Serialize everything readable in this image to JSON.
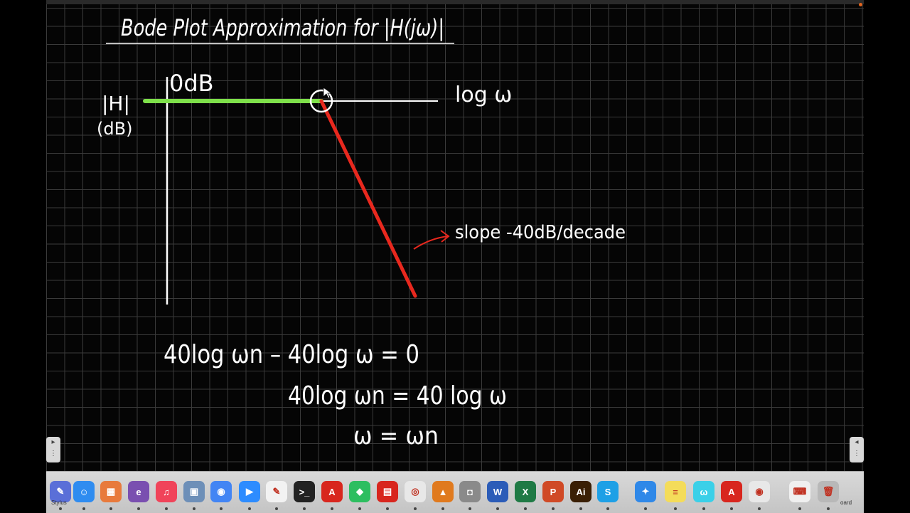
{
  "whiteboard": {
    "title": "Bode Plot Approximation for |H(jω)|",
    "y_axis_label_line1": "|H|",
    "y_axis_label_line2": "(dB)",
    "x_axis_label": "log ω",
    "zero_db_label": "0dB",
    "slope_annotation": "slope -40dB/decade",
    "equation_1": "40log ωn – 40log ω = 0",
    "equation_2": "40log ωn = 40 log ω",
    "equation_3": "ω = ωn",
    "colors": {
      "flat_segment": "#7ee04a",
      "slope_segment": "#e8281e",
      "ink": "#ffffff",
      "slope_text": "#e8281e"
    }
  },
  "side_tabs": {
    "left_icon": "panel-toggle-icon",
    "right_icon": "panel-toggle-icon"
  },
  "dock": {
    "left_label": "Stylus",
    "right_label": "oard",
    "apps": [
      {
        "name": "Stylus",
        "icon": "pen-icon",
        "color": "#5a6fd8",
        "glyph": "✎"
      },
      {
        "name": "Finder",
        "icon": "finder-icon",
        "color": "#2f8cf0",
        "glyph": "☺"
      },
      {
        "name": "Launchpad",
        "icon": "grid-icon",
        "color": "#e87a3c",
        "glyph": "▦"
      },
      {
        "name": "Emacs",
        "icon": "emacs-icon",
        "color": "#7a4fb0",
        "glyph": "e"
      },
      {
        "name": "Music",
        "icon": "music-icon",
        "color": "#f0445a",
        "glyph": "♫"
      },
      {
        "name": "Preview",
        "icon": "preview-icon",
        "color": "#6d8fb8",
        "glyph": "▣"
      },
      {
        "name": "Chrome",
        "icon": "chrome-icon",
        "color": "#4285f4",
        "glyph": "◉"
      },
      {
        "name": "Zoom",
        "icon": "video-icon",
        "color": "#2d8cff",
        "glyph": "▶"
      },
      {
        "name": "Notes",
        "icon": "edit-icon",
        "color": "#f2f2f2",
        "glyph": "✎"
      },
      {
        "name": "Terminal",
        "icon": "terminal-icon",
        "color": "#222222",
        "glyph": ">_"
      },
      {
        "name": "Acrobat",
        "icon": "pdf-icon",
        "color": "#d8261e",
        "glyph": "A"
      },
      {
        "name": "Evernote",
        "icon": "evernote-icon",
        "color": "#2dbe60",
        "glyph": "◆"
      },
      {
        "name": "Reader",
        "icon": "pdf-reader-icon",
        "color": "#d8261e",
        "glyph": "▤"
      },
      {
        "name": "Screen Recorder",
        "icon": "record-icon",
        "color": "#e8e8e8",
        "glyph": "◎"
      },
      {
        "name": "MATLAB",
        "icon": "matlab-icon",
        "color": "#e07a1e",
        "glyph": "▲"
      },
      {
        "name": "Screenshot",
        "icon": "camera-icon",
        "color": "#8a8a8a",
        "glyph": "◘"
      },
      {
        "name": "Word",
        "icon": "word-icon",
        "color": "#2b5cb8",
        "glyph": "W"
      },
      {
        "name": "Excel",
        "icon": "excel-icon",
        "color": "#1f7a45",
        "glyph": "X"
      },
      {
        "name": "PowerPoint",
        "icon": "powerpoint-icon",
        "color": "#d04a26",
        "glyph": "P"
      },
      {
        "name": "Illustrator",
        "icon": "illustrator-icon",
        "color": "#3a1f05",
        "glyph": "Ai"
      },
      {
        "name": "Skype",
        "icon": "skype-icon",
        "color": "#1ea0e6",
        "glyph": "S"
      },
      {
        "name": "Safari",
        "icon": "compass-icon",
        "color": "#2f88e8",
        "glyph": "✦"
      },
      {
        "name": "Stickies",
        "icon": "sticky-note-icon",
        "color": "#f4dc5a",
        "glyph": "≡"
      },
      {
        "name": "Whiteboard",
        "icon": "whiteboard-icon",
        "color": "#3ad0e8",
        "glyph": "ω"
      },
      {
        "name": "Acrobat Reader",
        "icon": "acrobat-icon",
        "color": "#d8261e",
        "glyph": "A"
      },
      {
        "name": "Photo Booth",
        "icon": "photo-icon",
        "color": "#e8e8e8",
        "glyph": "◉"
      },
      {
        "name": "Keyboard",
        "icon": "keyboard-icon",
        "color": "#f0f0f0",
        "glyph": "⌨"
      },
      {
        "name": "Trash",
        "icon": "trash-icon",
        "color": "#b8b8b8",
        "glyph": "🗑"
      }
    ]
  }
}
